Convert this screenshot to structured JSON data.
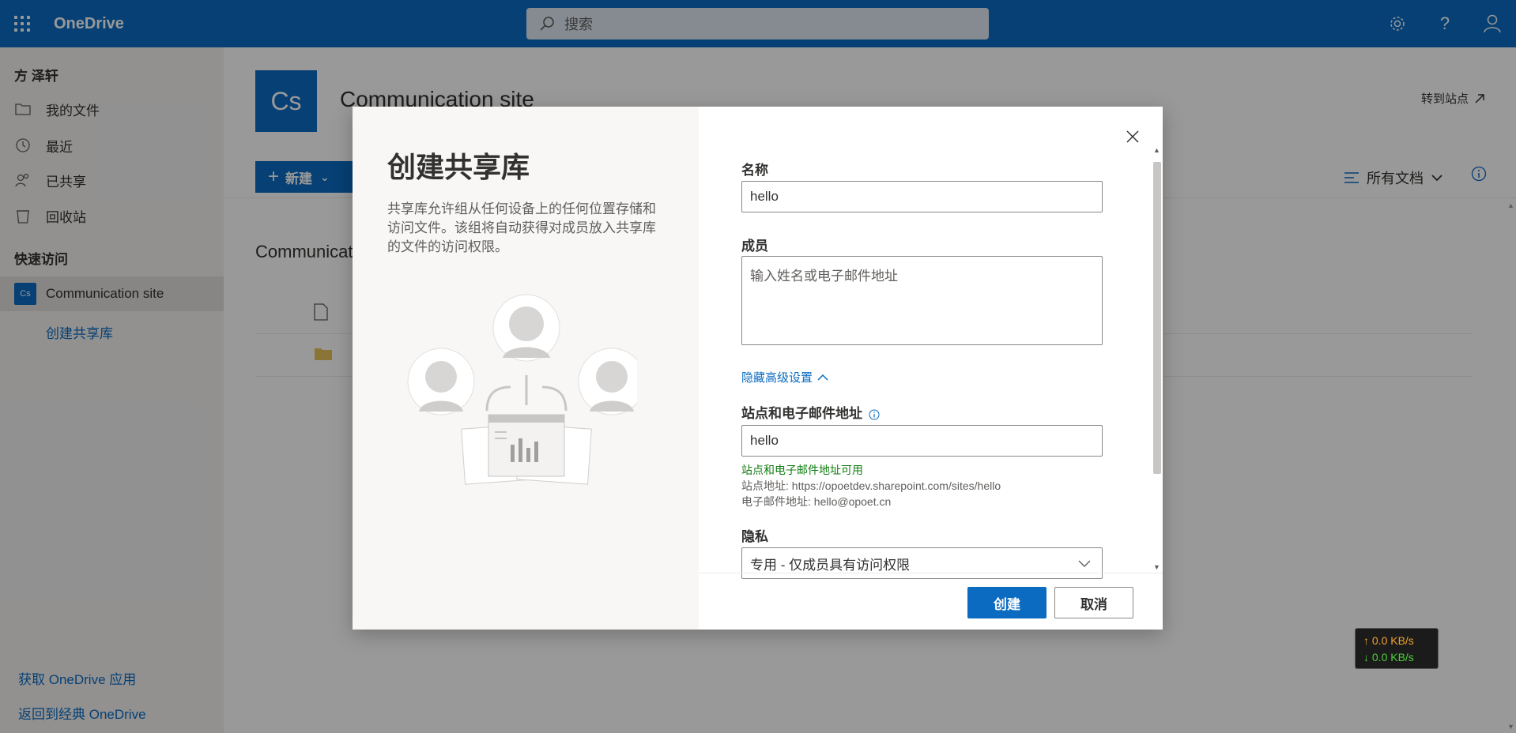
{
  "header": {
    "app_name": "OneDrive",
    "search_placeholder": "搜索"
  },
  "nav": {
    "user_name": "方 泽轩",
    "items": [
      {
        "label": "我的文件",
        "icon": "folder-icon"
      },
      {
        "label": "最近",
        "icon": "clock-icon"
      },
      {
        "label": "已共享",
        "icon": "people-icon"
      },
      {
        "label": "回收站",
        "icon": "recycle-bin-icon"
      }
    ],
    "quick_access_label": "快速访问",
    "site": {
      "badge": "Cs",
      "label": "Communication site"
    },
    "create_library": "创建共享库",
    "get_app": "获取 OneDrive 应用",
    "back_classic": "返回到经典 OneDrive"
  },
  "main": {
    "site_logo": "Cs",
    "site_title": "Communication site",
    "goto_site": "转到站点",
    "new_button": "新建",
    "view_selector": "所有文档",
    "breadcrumb": "Communicati"
  },
  "dialog": {
    "title": "创建共享库",
    "description": "共享库允许组从任何设备上的任何位置存储和访问文件。该组将自动获得对成员放入共享库的文件的访问权限。",
    "name_label": "名称",
    "name_value": "hello",
    "members_label": "成员",
    "members_placeholder": "输入姓名或电子邮件地址",
    "advanced_toggle": "隐藏高级设置",
    "address_label": "站点和电子邮件地址",
    "address_value": "hello",
    "availability": "站点和电子邮件地址可用",
    "site_address": "站点地址: https://opoetdev.sharepoint.com/sites/hello",
    "email_address": "电子邮件地址: hello@opoet.cn",
    "privacy_label": "隐私",
    "privacy_value": "专用 - 仅成员具有访问权限",
    "create_button": "创建",
    "cancel_button": "取消"
  },
  "netspeed": {
    "up": "0.0 KB/s",
    "down": "0.0 KB/s"
  },
  "colors": {
    "brand": "#0a6bc1",
    "success": "#107c10"
  }
}
